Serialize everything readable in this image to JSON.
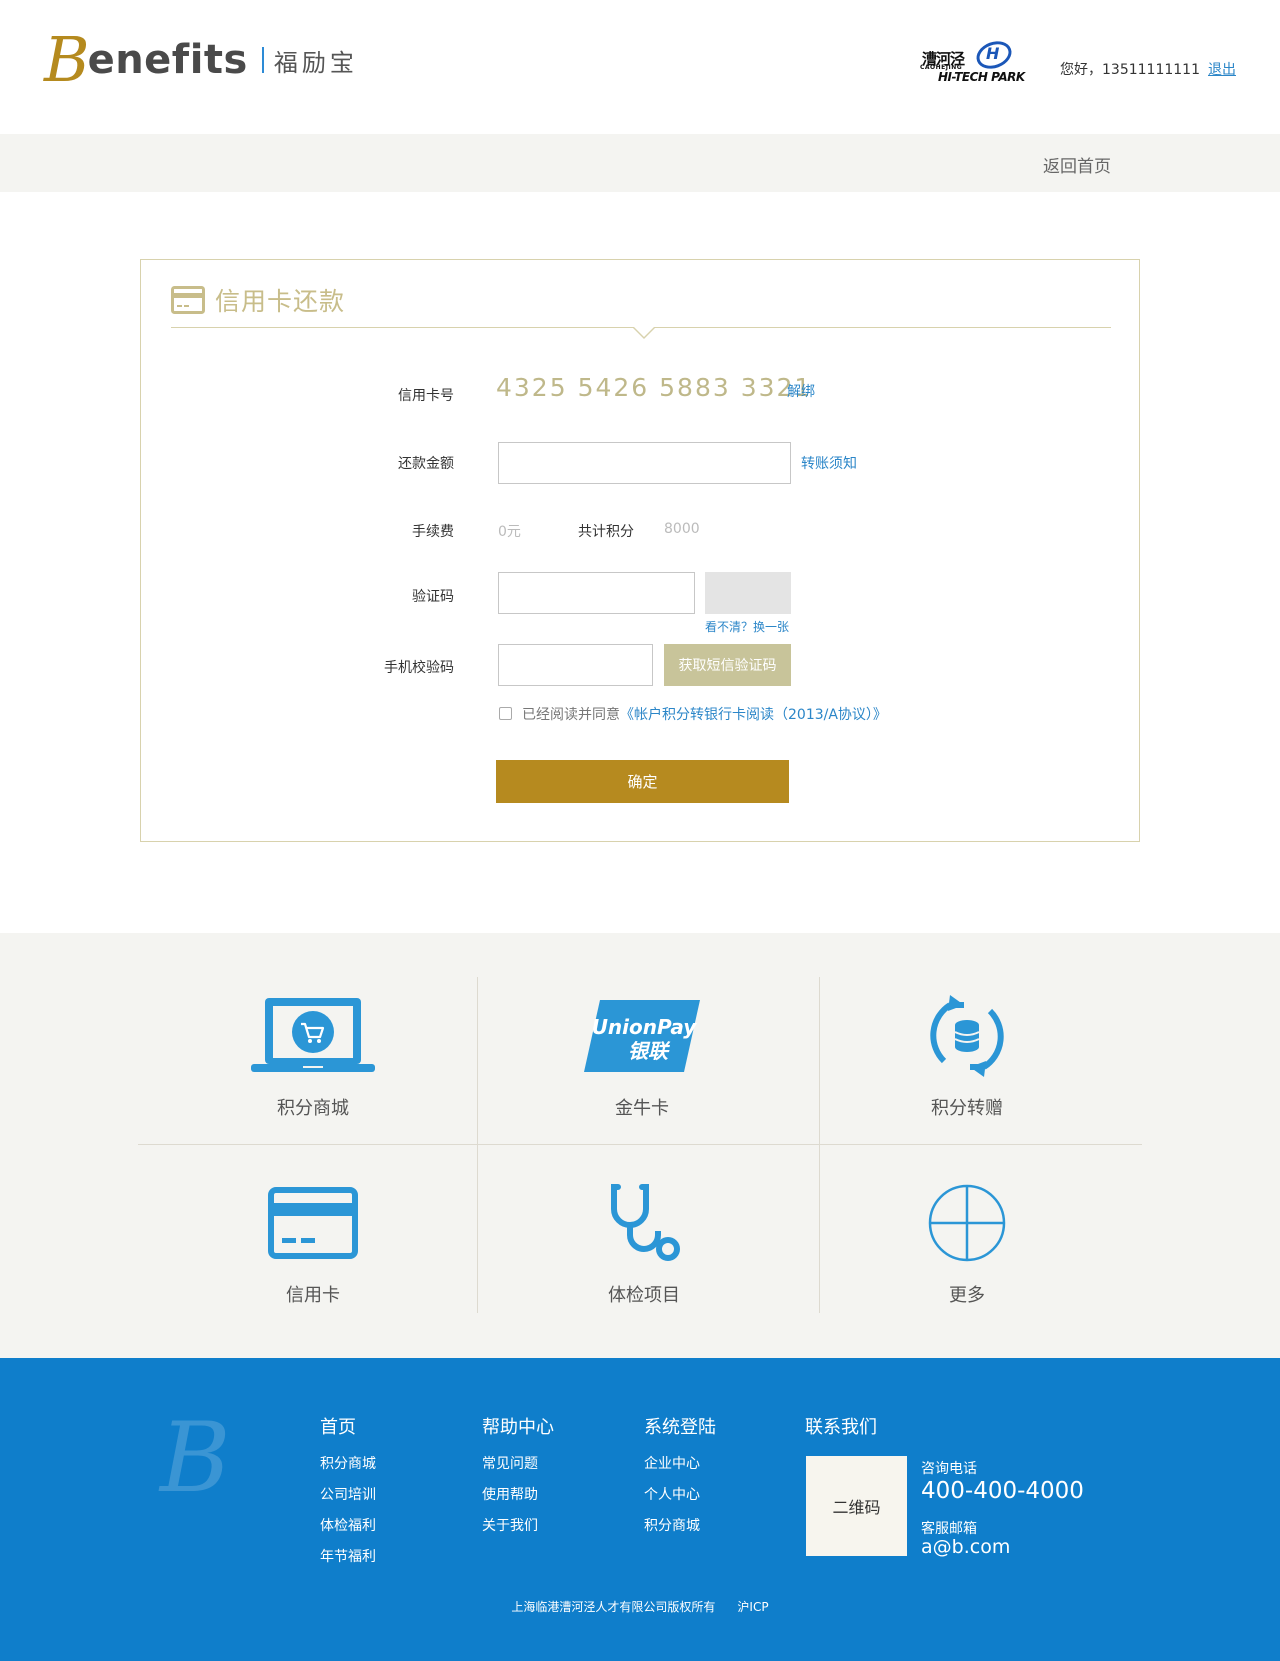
{
  "header": {
    "logo_letter": "B",
    "logo_word": "enefits",
    "logo_cn": "福励宝",
    "partner_cn": "漕河泾",
    "partner_sub": "CAOHEJING",
    "partner_en": "HI-TECH PARK",
    "partner_mark": "H",
    "greeting": "您好，13511111111",
    "logout": "退出"
  },
  "nav": {
    "home": "返回首页"
  },
  "form": {
    "title": "信用卡还款",
    "card_label": "信用卡号",
    "card_number": "4325 5426 5883 3321",
    "unbind": "解绑",
    "amount_label": "还款金额",
    "amount_value": "",
    "transfer_notice": "转账须知",
    "fee_label": "手续费",
    "fee_value": "0元",
    "points_label": "共计积分",
    "points_value": "8000",
    "captcha_label": "验证码",
    "captcha_value": "",
    "captcha_refresh": "看不清？换一张",
    "sms_label": "手机校验码",
    "sms_value": "",
    "sms_button": "获取短信验证码",
    "agree_prefix": "已经阅读并同意",
    "agree_link": "《帐户积分转银行卡阅读（2013/A协议）》",
    "submit": "确定"
  },
  "services": [
    {
      "label": "积分商城",
      "icon": "laptop-cart-icon"
    },
    {
      "label": "金牛卡",
      "icon": "unionpay-icon",
      "icon_text_1": "UnionPay",
      "icon_text_2": "银联"
    },
    {
      "label": "积分转赠",
      "icon": "coin-transfer-icon"
    },
    {
      "label": "信用卡",
      "icon": "credit-card-icon"
    },
    {
      "label": "体检项目",
      "icon": "stethoscope-icon"
    },
    {
      "label": "更多",
      "icon": "plus-circle-icon"
    }
  ],
  "footer": {
    "logo_letter": "B",
    "col1": {
      "title": "首页",
      "items": [
        "积分商城",
        "公司培训",
        "体检福利",
        "年节福利"
      ]
    },
    "col2": {
      "title": "帮助中心",
      "items": [
        "常见问题",
        "使用帮助",
        "关于我们"
      ]
    },
    "col3": {
      "title": "系统登陆",
      "items": [
        "企业中心",
        "个人中心",
        "积分商城"
      ]
    },
    "contact": {
      "title": "联系我们",
      "qr": "二维码",
      "phone_label": "咨询电话",
      "phone": "400-400-4000",
      "email_label": "客服邮箱",
      "email": "a@b.com"
    },
    "copyright": "上海临港漕河泾人才有限公司版权所有",
    "icp": "沪ICP"
  },
  "colors": {
    "gold": "#b68a1f",
    "khaki": "#c8bd8a",
    "link_blue": "#2b86c8",
    "icon_blue": "#2b96d6",
    "footer_blue": "#0f7ecb"
  }
}
